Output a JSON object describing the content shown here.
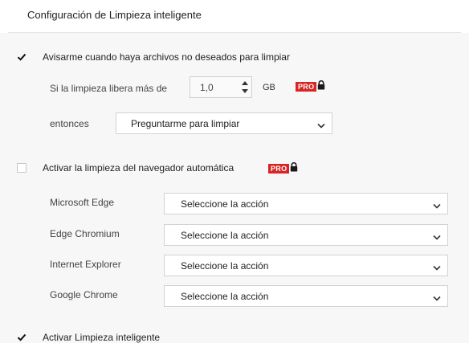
{
  "header": {
    "title": "Configuración de Limpieza inteligente"
  },
  "notify": {
    "checked": true,
    "label": "Avisarme cuando haya archivos no deseados para limpiar",
    "threshold_label": "Si la limpieza libera más de",
    "threshold_value": "1,0",
    "unit": "GB",
    "pro_badge": "PRO",
    "then_label": "entonces",
    "then_selected": "Preguntarme para limpiar"
  },
  "browser": {
    "checked": false,
    "label": "Activar la limpieza del navegador automática",
    "pro_badge": "PRO",
    "rows": [
      {
        "name": "Microsoft Edge",
        "selected": "Seleccione la acción"
      },
      {
        "name": "Edge Chromium",
        "selected": "Seleccione la acción"
      },
      {
        "name": "Internet Explorer",
        "selected": "Seleccione la acción"
      },
      {
        "name": "Google Chrome",
        "selected": "Seleccione la acción"
      }
    ]
  },
  "smart": {
    "checked": true,
    "label": "Activar Limpieza inteligente"
  },
  "colors": {
    "pro_red": "#d62626",
    "section_bg": "#f7f7f7",
    "border": "#d2d2d2"
  }
}
